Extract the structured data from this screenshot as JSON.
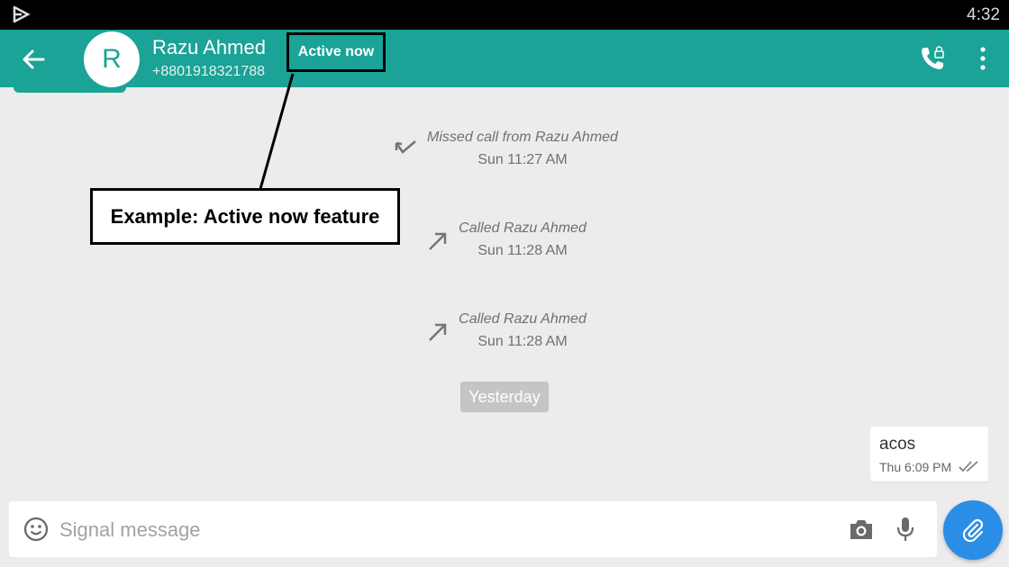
{
  "status_bar": {
    "time": "4:32",
    "app_icon": "play-store-icon"
  },
  "header": {
    "back_icon": "back-arrow-icon",
    "avatar_initial": "R",
    "contact_name": "Razu Ahmed",
    "contact_number": "+8801918321788",
    "status_label": "Active now",
    "call_icon": "secure-call-icon",
    "menu_icon": "overflow-menu-icon"
  },
  "annotation": {
    "label": "Example: Active now feature"
  },
  "events": [
    {
      "title": "Missed call from Razu Ahmed",
      "time": "Sun 11:27 AM",
      "icon": "missed-call-icon"
    },
    {
      "title": "Called Razu Ahmed",
      "time": "Sun 11:28 AM",
      "icon": "outgoing-call-icon"
    },
    {
      "title": "Called Razu Ahmed",
      "time": "Sun 11:28 AM",
      "icon": "outgoing-call-icon"
    }
  ],
  "date_divider": "Yesterday",
  "messages": [
    {
      "text": "acos",
      "time": "Thu 6:09 PM",
      "status_icon": "delivered-checks-icon"
    }
  ],
  "composer": {
    "placeholder": "Signal message",
    "emoji_icon": "emoji-icon",
    "camera_icon": "camera-icon",
    "mic_icon": "microphone-icon",
    "attach_icon": "paperclip-icon"
  },
  "colors": {
    "toolbar": "#1aa396",
    "background": "#ececec",
    "fab": "#2a8ee6"
  }
}
